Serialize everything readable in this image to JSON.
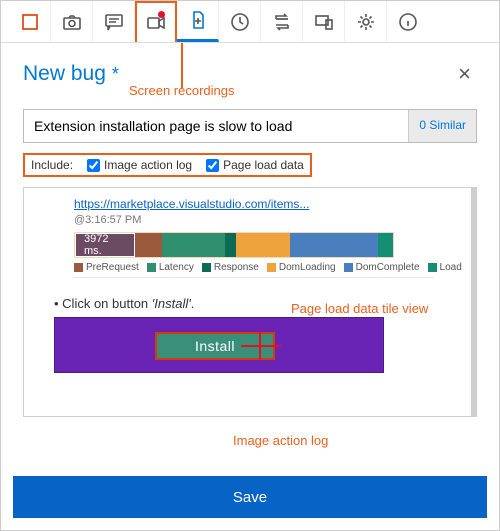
{
  "toolbar": {
    "icons": {
      "stop": "stop-icon",
      "camera": "camera-icon",
      "comment": "comment-icon",
      "video": "video-icon",
      "add_doc": "add-document-icon",
      "clock": "clock-icon",
      "repeat": "repeat-icon",
      "devices": "devices-icon",
      "settings": "gear-icon",
      "info": "info-icon"
    }
  },
  "annotations": {
    "video_label": "Screen recordings",
    "page_load_tile": "Page load data tile view",
    "image_action_log": "Image action log"
  },
  "header": {
    "title": "New bug",
    "dirty_marker": "*",
    "close": "×"
  },
  "bug": {
    "title_value": "Extension installation page is slow to load",
    "similar_label": "0 Similar"
  },
  "include": {
    "label": "Include:",
    "image_action_log": {
      "label": "Image action log",
      "checked": true
    },
    "page_load_data": {
      "label": "Page load data",
      "checked": true
    }
  },
  "page_load": {
    "url": "https://marketplace.visualstudio.com/items...",
    "timestamp": "@3:16:57 PM",
    "total_ms_label": "3972 ms."
  },
  "chart_data": {
    "type": "bar",
    "orientation": "stacked-horizontal",
    "total_ms": 3972,
    "series": [
      {
        "name": "PreRequest",
        "ms": 420,
        "color": "#9b5a3c"
      },
      {
        "name": "Latency",
        "ms": 960,
        "color": "#2f8f6f"
      },
      {
        "name": "Response",
        "ms": 180,
        "color": "#0b6b55"
      },
      {
        "name": "DomLoading",
        "ms": 820,
        "color": "#f0a23c"
      },
      {
        "name": "DomComplete",
        "ms": 1362,
        "color": "#4a7fbf"
      },
      {
        "name": "Load",
        "ms": 230,
        "color": "#158f73"
      }
    ]
  },
  "steps": {
    "step1_prefix": "• Click on button ",
    "step1_target": "'Install'",
    "step1_suffix": ".",
    "install_button_text": "Install"
  },
  "footer": {
    "save_label": "Save"
  }
}
